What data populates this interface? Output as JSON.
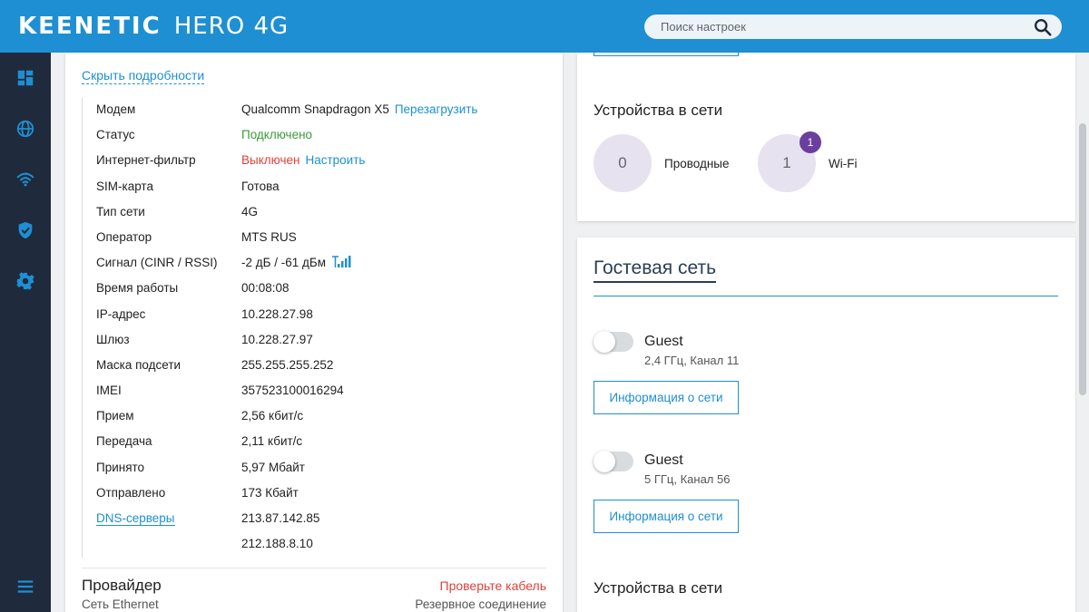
{
  "header": {
    "brand": "KEENETIC",
    "model": "HERO 4G",
    "search_placeholder": "Поиск настроек"
  },
  "sidebar": {
    "items": [
      {
        "name": "dashboard",
        "icon": "dashboard-icon"
      },
      {
        "name": "internet",
        "icon": "globe-icon"
      },
      {
        "name": "wifi",
        "icon": "wifi-icon"
      },
      {
        "name": "security",
        "icon": "shield-icon"
      },
      {
        "name": "settings",
        "icon": "gear-icon"
      },
      {
        "name": "menu",
        "icon": "hamburger-icon"
      }
    ]
  },
  "modem_panel": {
    "hide_details": "Скрыть подробности",
    "rows": [
      {
        "label": "Модем",
        "value": "Qualcomm Snapdragon X5",
        "action": "Перезагрузить"
      },
      {
        "label": "Статус",
        "value": "Подключено"
      },
      {
        "label": "Интернет-фильтр",
        "value": "Выключен",
        "action": "Настроить"
      },
      {
        "label": "SIM-карта",
        "value": "Готова"
      },
      {
        "label": "Тип сети",
        "value": "4G"
      },
      {
        "label": "Оператор",
        "value": "MTS RUS"
      },
      {
        "label": "Сигнал (CINR / RSSI)",
        "value": "-2 дБ / -61 дБм"
      },
      {
        "label": "Время работы",
        "value": "00:08:08"
      },
      {
        "label": "IP-адрес",
        "value": "10.228.27.98"
      },
      {
        "label": "Шлюз",
        "value": "10.228.27.97"
      },
      {
        "label": "Маска подсети",
        "value": "255.255.255.252"
      },
      {
        "label": "IMEI",
        "value": "357523100016294"
      },
      {
        "label": "Прием",
        "value": "2,56 кбит/с"
      },
      {
        "label": "Передача",
        "value": "2,11 кбит/с"
      },
      {
        "label": "Принято",
        "value": "5,97 Мбайт"
      },
      {
        "label": "Отправлено",
        "value": "173 Кбайт"
      },
      {
        "label": "DNS-серверы",
        "value": "213.87.142.85"
      },
      {
        "label": "",
        "value": "212.188.8.10"
      }
    ],
    "provider": {
      "title": "Провайдер",
      "status": "Проверьте кабель",
      "subtitle": "Сеть Ethernet",
      "backup": "Резервное соединение"
    }
  },
  "devices_top": {
    "title": "Устройства в сети",
    "wired_count": "0",
    "wired_label": "Проводные",
    "wifi_count": "1",
    "wifi_badge": "1",
    "wifi_label": "Wi-Fi"
  },
  "guest": {
    "title": "Гостевая сеть",
    "networks": [
      {
        "name": "Guest",
        "details": "2,4 ГГц, Канал 11",
        "enabled": false,
        "button": "Информация о сети"
      },
      {
        "name": "Guest",
        "details": "5 ГГц, Канал 56",
        "enabled": false,
        "button": "Информация о сети"
      }
    ],
    "devices_title": "Устройства в сети"
  },
  "colors": {
    "header_bg": "#1e8fd2",
    "sidebar_bg": "#1f2a3c",
    "link": "#1e8fd2",
    "success": "#3a9a3a",
    "error": "#e0403a",
    "badge": "#6b3fa0"
  }
}
